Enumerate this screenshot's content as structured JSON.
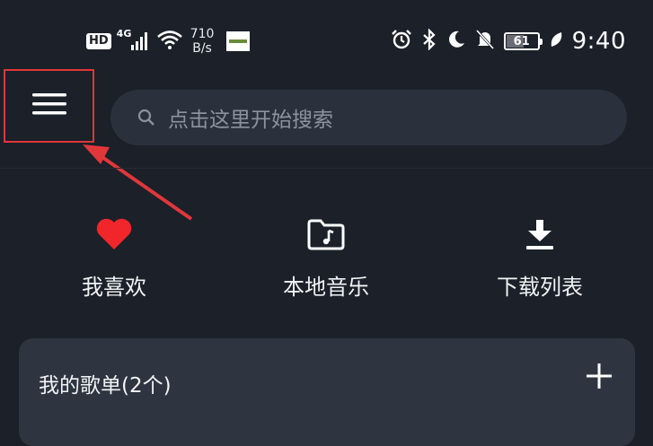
{
  "status_bar": {
    "hd_label": "HD",
    "network_label": "4G",
    "speed_value": "710",
    "speed_unit": "B/s",
    "battery_level": "61",
    "time": "9:40"
  },
  "search": {
    "placeholder": "点击这里开始搜索"
  },
  "shortcuts": [
    {
      "label": "我喜欢",
      "icon": "heart-icon",
      "color": "#f0262a"
    },
    {
      "label": "本地音乐",
      "icon": "music-folder-icon"
    },
    {
      "label": "下载列表",
      "icon": "download-icon"
    }
  ],
  "playlist": {
    "title": "我的歌单(2个)",
    "add_icon": "plus-icon"
  },
  "colors": {
    "background": "#1b2029",
    "highlight": "#e0373a",
    "card": "#2f3540"
  }
}
